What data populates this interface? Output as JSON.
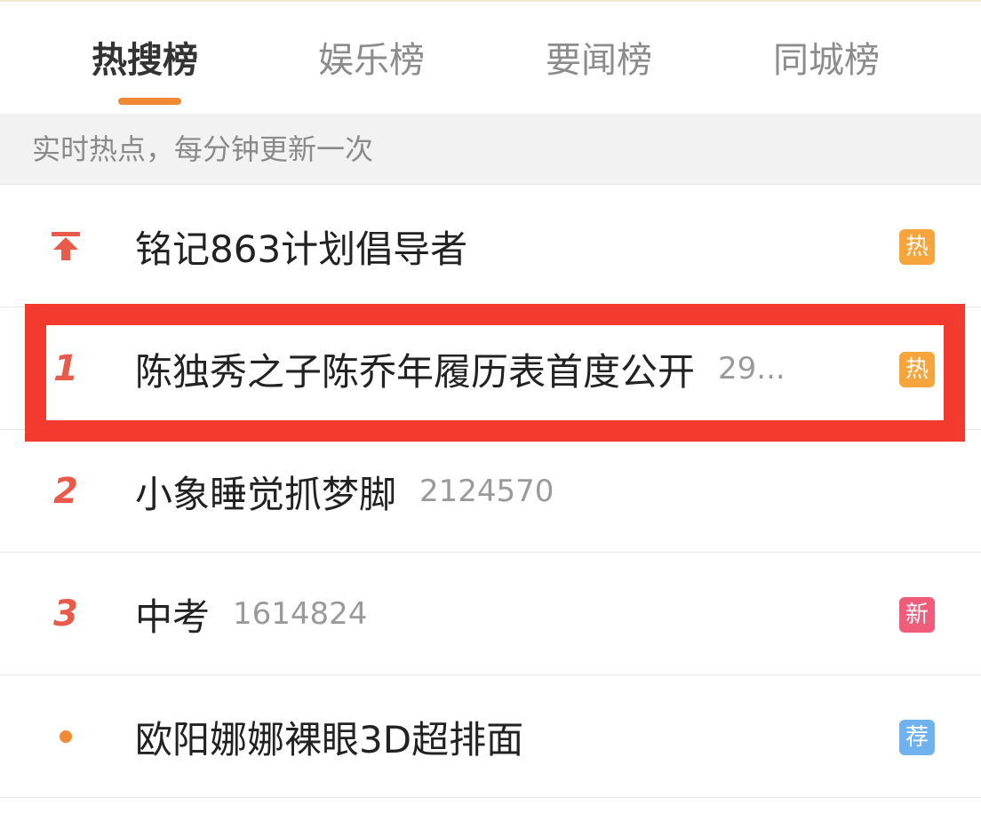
{
  "tabs": [
    {
      "label": "热搜榜",
      "active": true
    },
    {
      "label": "娱乐榜",
      "active": false
    },
    {
      "label": "要闻榜",
      "active": false
    },
    {
      "label": "同城榜",
      "active": false
    }
  ],
  "info_bar": {
    "text": "实时热点，每分钟更新一次"
  },
  "list": [
    {
      "rank_icon": "pin-top-icon",
      "title": "铭记863计划倡导者",
      "count": "",
      "badge": "热",
      "badge_color": "#f6a53c"
    },
    {
      "rank": "1",
      "title": "陈独秀之子陈乔年履历表首度公开",
      "count": "29...",
      "badge": "热",
      "badge_color": "#f6a53c"
    },
    {
      "rank": "2",
      "title": "小象睡觉抓梦脚",
      "count": "2124570",
      "badge": "",
      "badge_color": ""
    },
    {
      "rank": "3",
      "title": "中考",
      "count": "1614824",
      "badge": "新",
      "badge_color": "#f05c7a"
    },
    {
      "rank_icon": "dot-icon",
      "title": "欧阳娜娜裸眼3D超排面",
      "count": "",
      "badge": "荐",
      "badge_color": "#6fb2ee"
    }
  ],
  "colors": {
    "accent": "#f08a35",
    "rank_red": "#e85a4a",
    "highlight_red": "#f23a2e"
  }
}
